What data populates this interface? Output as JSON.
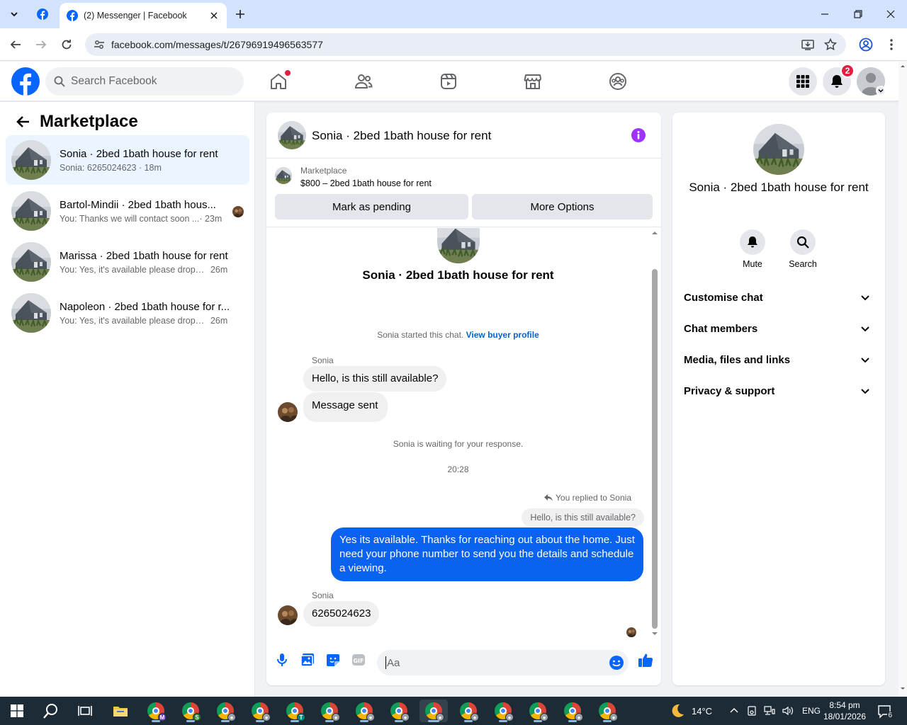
{
  "browser": {
    "tab_title": "(2) Messenger | Facebook",
    "url": "facebook.com/messages/t/26796919496563577"
  },
  "fb": {
    "search_placeholder": "Search Facebook",
    "notification_count": "2",
    "brand_color": "#0866ff"
  },
  "left": {
    "title": "Marketplace",
    "chats": [
      {
        "name": "Sonia · 2bed 1bath house for rent",
        "preview": "Sonia: 6265024623",
        "time": "· 18m"
      },
      {
        "name": "Bartol-Mindii · 2bed 1bath hous...",
        "preview": "You: Thanks we will contact soon ...",
        "time": "· 23m"
      },
      {
        "name": "Marissa · 2bed 1bath house for rent",
        "preview": "You: Yes, it's available please drop y...",
        "time": "26m"
      },
      {
        "name": "Napoleon · 2bed 1bath house for r...",
        "preview": "You: Yes, it's available please drop y...",
        "time": "26m"
      }
    ]
  },
  "chat": {
    "title": "Sonia · 2bed 1bath house for rent",
    "marketplace_label": "Marketplace",
    "listing": "$800 – 2bed 1bath house for rent",
    "btn_pending": "Mark as pending",
    "btn_more": "More Options",
    "center_name": "Sonia · 2bed 1bath house for rent",
    "started_text": "Sonia started this chat.",
    "view_profile": "View buyer profile",
    "sender1": "Sonia",
    "msg1": "Hello, is this still available?",
    "msg2": "Message sent",
    "waiting": "Sonia is waiting for your response.",
    "timestamp": "20:28",
    "replied_note": "You replied to Sonia",
    "quoted": "Hello, is this still available?",
    "my_msg": "Yes its available. Thanks for reaching out about the home. Just need your phone number to send you the details and schedule a viewing.",
    "sender2": "Sonia",
    "msg3": "6265024623",
    "composer_placeholder": "Aa",
    "accent": "#0a63f0"
  },
  "right": {
    "name": "Sonia · 2bed 1bath house for rent",
    "mute": "Mute",
    "search": "Search",
    "sections": [
      "Customise chat",
      "Chat members",
      "Media, files and links",
      "Privacy & support"
    ]
  },
  "taskbar": {
    "temp": "14°C",
    "lang": "ENG",
    "time": "8:54 pm",
    "date": "18/01/2026",
    "notifications": "6"
  }
}
